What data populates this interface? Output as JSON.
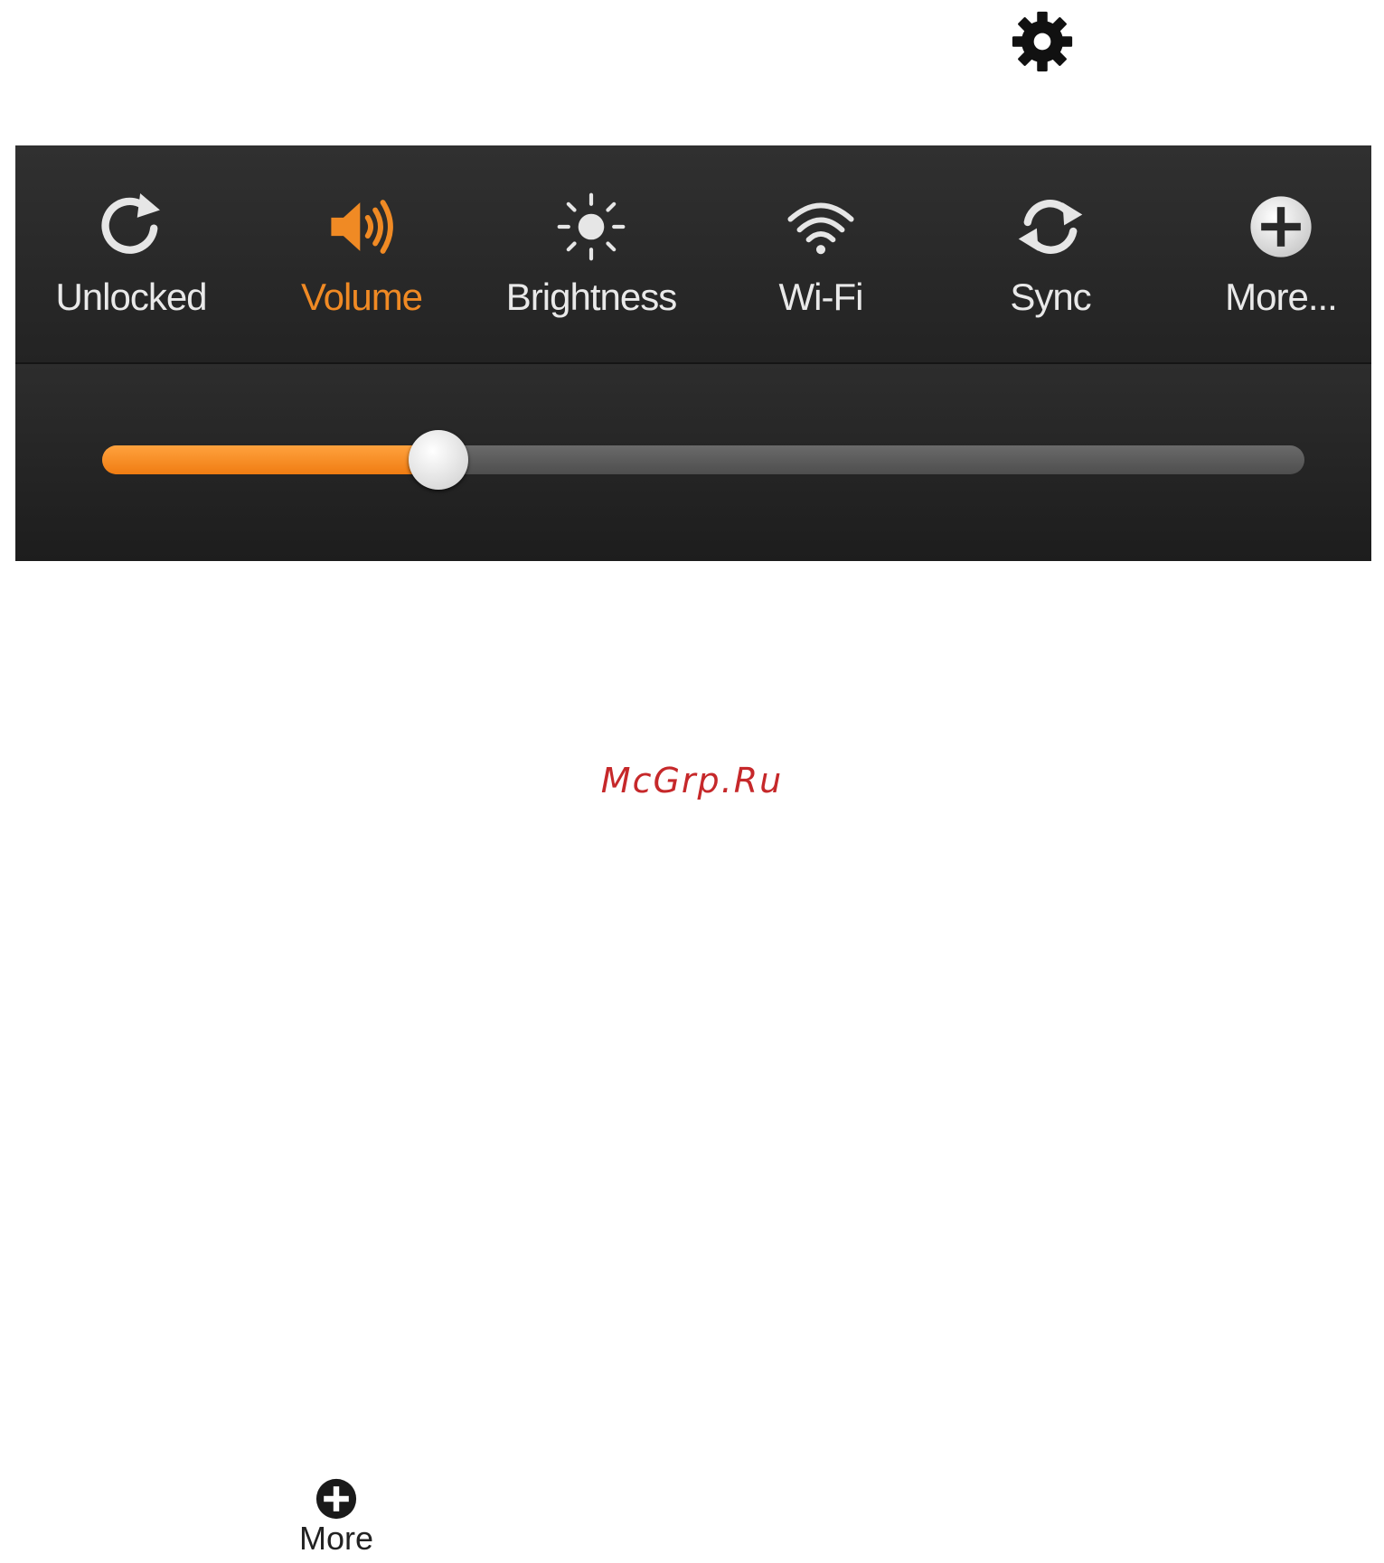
{
  "header": {
    "settings_icon": "gear-icon"
  },
  "quick_settings": {
    "items": [
      {
        "label": "Unlocked",
        "icon": "rotation-lock-icon",
        "active": false
      },
      {
        "label": "Volume",
        "icon": "volume-icon",
        "active": true
      },
      {
        "label": "Brightness",
        "icon": "brightness-icon",
        "active": false
      },
      {
        "label": "Wi-Fi",
        "icon": "wifi-icon",
        "active": false
      },
      {
        "label": "Sync",
        "icon": "sync-icon",
        "active": false
      },
      {
        "label": "More...",
        "icon": "plus-circle-icon",
        "active": false
      }
    ],
    "volume_slider": {
      "value_fraction": 0.28
    }
  },
  "watermark": {
    "text": "McGrp.Ru"
  },
  "bottom_more": {
    "label": "More",
    "icon": "plus-circle-icon"
  },
  "colors": {
    "accent": "#f08a24",
    "panel_bg": "#262626",
    "label": "#e9e9e9",
    "watermark": "#c6282a"
  }
}
